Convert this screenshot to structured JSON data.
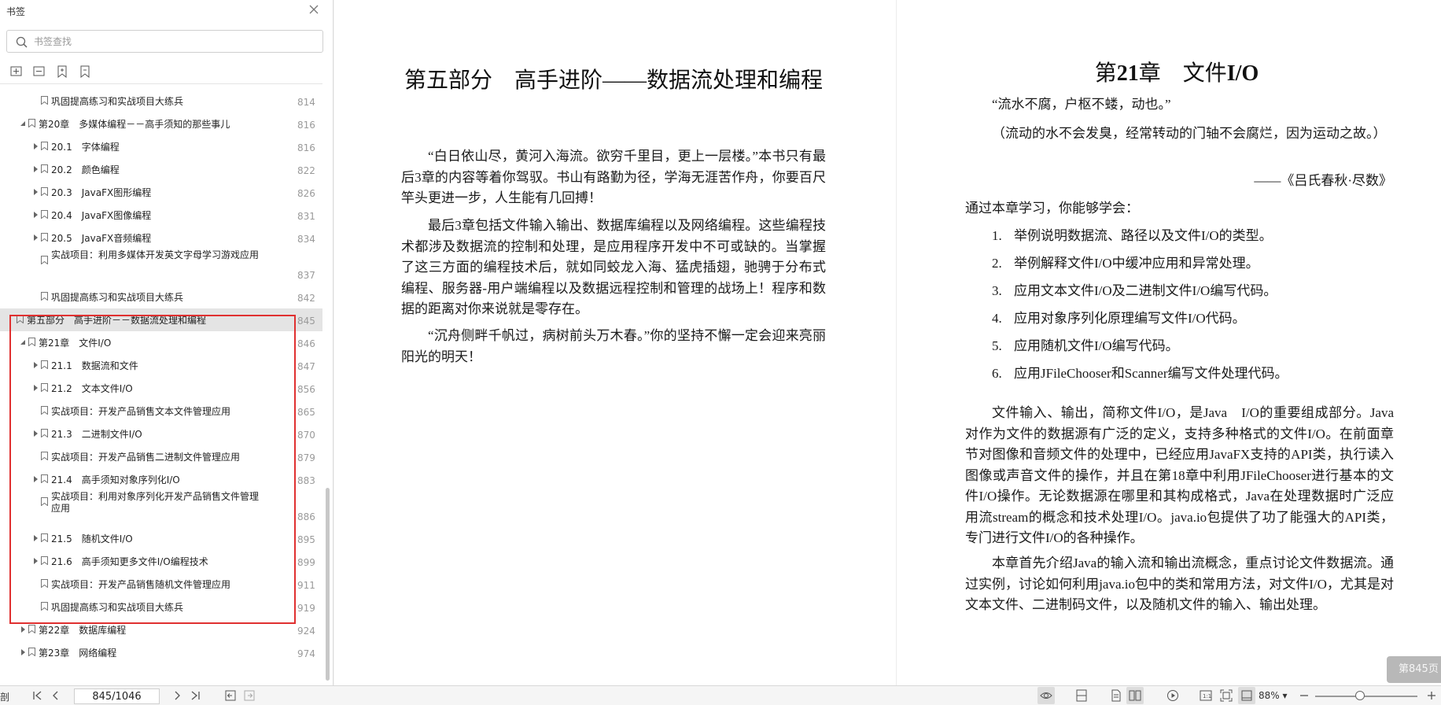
{
  "sidebar": {
    "title": "书签",
    "search_placeholder": "书签查找",
    "items": [
      {
        "label": "巩固提高练习和实战项目大练兵",
        "page": "814",
        "level": 2,
        "arrow": "none"
      },
      {
        "label": "第20章　多媒体编程－－高手须知的那些事儿",
        "page": "816",
        "level": 1,
        "arrow": "down"
      },
      {
        "label": "20.1　字体编程",
        "page": "816",
        "level": 2,
        "arrow": "right"
      },
      {
        "label": "20.2　颜色编程",
        "page": "822",
        "level": 2,
        "arrow": "right"
      },
      {
        "label": "20.3　JavaFX图形编程",
        "page": "826",
        "level": 2,
        "arrow": "right"
      },
      {
        "label": "20.4　JavaFX图像编程",
        "page": "831",
        "level": 2,
        "arrow": "right"
      },
      {
        "label": "20.5　JavaFX音频编程",
        "page": "834",
        "level": 2,
        "arrow": "right"
      },
      {
        "label": "实战项目：利用多媒体开发英文字母学习游戏应用",
        "page": "837",
        "level": 2,
        "arrow": "none",
        "tall": true
      },
      {
        "label": "巩固提高练习和实战项目大练兵",
        "page": "842",
        "level": 2,
        "arrow": "none"
      },
      {
        "label": "第五部分　高手进阶－－数据流处理和编程",
        "page": "845",
        "level": 0,
        "arrow": "none",
        "selected": true
      },
      {
        "label": "第21章　文件I/O",
        "page": "846",
        "level": 1,
        "arrow": "down"
      },
      {
        "label": "21.1　数据流和文件",
        "page": "847",
        "level": 2,
        "arrow": "right"
      },
      {
        "label": "21.2　文本文件I/O",
        "page": "856",
        "level": 2,
        "arrow": "right"
      },
      {
        "label": "实战项目：开发产品销售文本文件管理应用",
        "page": "865",
        "level": 2,
        "arrow": "none"
      },
      {
        "label": "21.3　二进制文件I/O",
        "page": "870",
        "level": 2,
        "arrow": "right"
      },
      {
        "label": "实战项目：开发产品销售二进制文件管理应用",
        "page": "879",
        "level": 2,
        "arrow": "none"
      },
      {
        "label": "21.4　高手须知对象序列化I/O",
        "page": "883",
        "level": 2,
        "arrow": "right"
      },
      {
        "label": "实战项目：利用对象序列化开发产品销售文件管理应用",
        "page": "886",
        "level": 2,
        "arrow": "none",
        "tall": true
      },
      {
        "label": "21.5　随机文件I/O",
        "page": "895",
        "level": 2,
        "arrow": "right"
      },
      {
        "label": "21.6　高手须知更多文件I/O编程技术",
        "page": "899",
        "level": 2,
        "arrow": "right"
      },
      {
        "label": "实战项目：开发产品销售随机文件管理应用",
        "page": "911",
        "level": 2,
        "arrow": "none"
      },
      {
        "label": "巩固提高练习和实战项目大练兵",
        "page": "919",
        "level": 2,
        "arrow": "none"
      },
      {
        "label": "第22章　数据库编程",
        "page": "924",
        "level": 1,
        "arrow": "right"
      },
      {
        "label": "第23章　网络编程",
        "page": "974",
        "level": 1,
        "arrow": "right"
      }
    ]
  },
  "left_page": {
    "title": "第五部分　高手进阶——数据流处理和编程",
    "paragraphs": [
      "“白日依山尽，黄河入海流。欲穷千里目，更上一层楼。”本书只有最后3章的内容等着你驾驭。书山有路勤为径，学海无涯苦作舟，你要百尺竿头更进一步，人生能有几回搏！",
      "最后3章包括文件输入输出、数据库编程以及网络编程。这些编程技术都涉及数据流的控制和处理，是应用程序开发中不可或缺的。当掌握了这三方面的编程技术后，就如同蛟龙入海、猛虎插翅，驰骋于分布式编程、服务器-用户端编程以及数据远程控制和管理的战场上！程序和数据的距离对你来说就是零存在。",
      "“沉舟侧畔千帆过，病树前头万木春。”你的坚持不懈一定会迎来亮丽阳光的明天！"
    ]
  },
  "right_page": {
    "title_prefix": "第",
    "title_num": "21",
    "title_mid": "章　文件",
    "title_io": "I/O",
    "quote": "“流水不腐，户枢不蝼，动也。”",
    "quote_explain": "（流动的水不会发臭，经常转动的门轴不会腐烂，因为运动之故。）",
    "quote_source": "——《吕氏春秋·尽数》",
    "intro": "通过本章学习，你能够学会：",
    "list": [
      {
        "num": "1.",
        "text": "举例说明数据流、路径以及文件I/O的类型。"
      },
      {
        "num": "2.",
        "text": "举例解释文件I/O中缓冲应用和异常处理。"
      },
      {
        "num": "3.",
        "text": "应用文本文件I/O及二进制文件I/O编写代码。"
      },
      {
        "num": "4.",
        "text": "应用对象序列化原理编写文件I/O代码。"
      },
      {
        "num": "5.",
        "text": "应用随机文件I/O编写代码。"
      },
      {
        "num": "6.",
        "text": "应用JFileChooser和Scanner编写文件处理代码。"
      }
    ],
    "paragraphs": [
      "文件输入、输出，简称文件I/O，是Java　I/O的重要组成部分。Java对作为文件的数据源有广泛的定义，支持多种格式的文件I/O。在前面章节对图像和音频文件的处理中，已经应用JavaFX支持的API类，执行读入图像或声音文件的操作，并且在第18章中利用JFileChooser进行基本的文件I/O操作。无论数据源在哪里和其构成格式，Java在处理数据时广泛应用流stream的概念和技术处理I/O。java.io包提供了功了能强大的API类，专门进行文件I/O的各种操作。",
      "本章首先介绍Java的输入流和输出流概念，重点讨论文件数据流。通过实例，讨论如何利用java.io包中的类和常用方法，对文件I/O，尤其是对文本文件、二进制码文件，以及随机文件的输入、输出处理。"
    ],
    "page_badge": "第845页"
  },
  "toolbar": {
    "left_text": "剖",
    "page_value": "845/1046",
    "zoom": "88%"
  },
  "colors": {
    "highlight_box": "#e03030",
    "selected_row": "#e4e4e4"
  }
}
